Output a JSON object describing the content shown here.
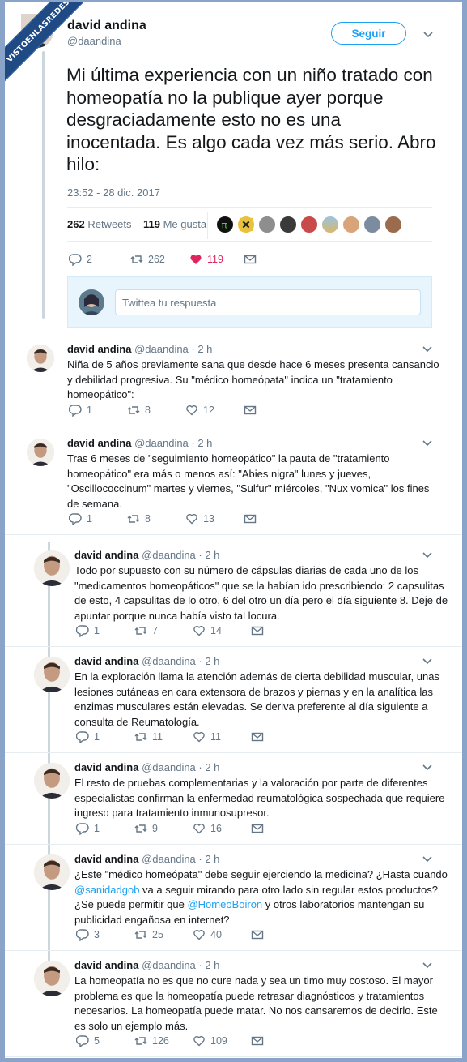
{
  "watermark": "VISTOENLASREDES",
  "main_tweet": {
    "author_name": "david andina",
    "author_handle": "@daandina",
    "follow_label": "Seguir",
    "text": "Mi última experiencia con un niño tratado con homeopatía no la publique ayer porque desgraciadamente esto no es una inocentada. Es algo cada vez más serio. Abro hilo:",
    "timestamp": "23:52 - 28 dic. 2017",
    "retweets_count": "262",
    "retweets_label": "Retweets",
    "likes_count": "119",
    "likes_label": "Me gusta",
    "actions": {
      "replies": "2",
      "retweets": "262",
      "likes": "119"
    },
    "reply_placeholder": "Twittea tu respuesta"
  },
  "replies": [
    {
      "name": "david andina",
      "meta": "@daandina · 2 h",
      "lines": [
        "Niña de 5 años previamente sana que desde hace 6 meses presenta cansancio",
        "y debilidad progresiva. Su \"médico homeópata\" indica un \"tratamiento",
        "homeopático\":"
      ],
      "replies": "1",
      "retweets": "8",
      "likes": "12"
    },
    {
      "name": "david andina",
      "meta": "@daandina · 2 h",
      "lines": [
        "Tras 6 meses de \"seguimiento homeopático\" la pauta de \"tratamiento",
        "homeopático\" era más o menos así: \"Abies nigra\" lunes y jueves,",
        "\"Oscillococcinum\" martes y viernes, \"Sulfur\" miércoles, \"Nux vomica\" los fines",
        "de semana."
      ],
      "replies": "1",
      "retweets": "8",
      "likes": "13"
    },
    {
      "name": "david andina",
      "meta": "@daandina · 2 h",
      "lines": [
        "Todo por supuesto con su número de cápsulas diarias de cada uno de los",
        "\"medicamentos homeopáticos\" que se la habían ido prescribiendo: 2 capsulitas",
        "de esto, 4 capsulitas de lo otro, 6 del otro un día pero el día siguiente 8. Deje de",
        "apuntar porque nunca había visto tal locura."
      ],
      "replies": "1",
      "retweets": "7",
      "likes": "14"
    },
    {
      "name": "david andina",
      "meta": "@daandina · 2 h",
      "lines": [
        "En la exploración llama la atención además de cierta debilidad muscular, unas",
        "lesiones cutáneas en cara extensora de brazos y piernas y en la analítica las",
        "enzimas musculares están elevadas. Se deriva preferente al día siguiente a",
        "consulta de Reumatología."
      ],
      "replies": "1",
      "retweets": "11",
      "likes": "11"
    },
    {
      "name": "david andina",
      "meta": "@daandina · 2 h",
      "lines": [
        "El resto de pruebas complementarias y la valoración por parte de diferentes",
        "especialistas confirman la enfermedad reumatológica sospechada que requiere",
        "ingreso para tratamiento inmunosupresor."
      ],
      "replies": "1",
      "retweets": "9",
      "likes": "16"
    },
    {
      "name": "david andina",
      "meta": "@daandina · 2 h",
      "lines": [
        "¿Este \"médico homeópata\" debe seguir ejerciendo la medicina? ¿Hasta cuando",
        "@sanidadgob va a seguir mirando para otro lado sin regular estos productos?",
        "¿Se puede permitir que @HomeoBoiron y otros laboratorios mantengan su",
        "publicidad engañosa en internet?"
      ],
      "mentions": [
        "@sanidadgob",
        "@HomeoBoiron"
      ],
      "replies": "3",
      "retweets": "25",
      "likes": "40"
    },
    {
      "name": "david andina",
      "meta": "@daandina · 2 h",
      "lines": [
        "La homeopatía no es que no cure nada y sea un timo muy costoso. El mayor",
        "problema es que la homeopatía puede retrasar diagnósticos y tratamientos",
        "necesarios. La homeopatía puede matar. No nos cansaremos de decirlo.  Este",
        "es solo un ejemplo más."
      ],
      "replies": "5",
      "retweets": "126",
      "likes": "109"
    }
  ],
  "colors": {
    "accent": "#1da1f2",
    "like": "#e0245e",
    "muted": "#657786",
    "thread_line": "#ccd6dd"
  },
  "icons": [
    "reply-icon",
    "retweet-icon",
    "heart-icon",
    "dm-icon",
    "chevron-down-icon"
  ]
}
